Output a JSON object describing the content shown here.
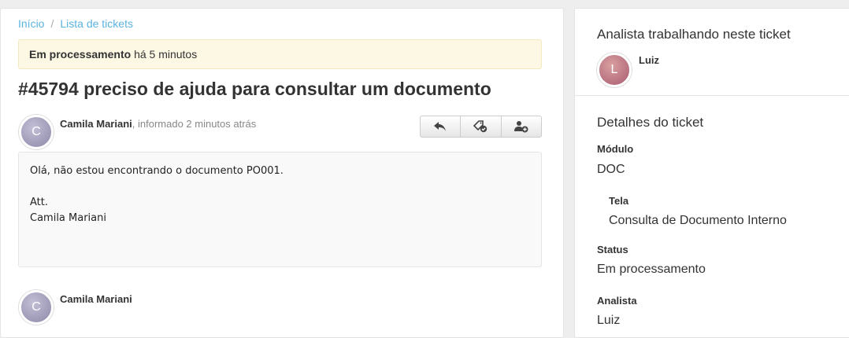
{
  "breadcrumb": {
    "home": "Início",
    "separator": "/",
    "list": "Lista de tickets"
  },
  "status": {
    "state": "Em processamento",
    "elapsed": "há 5 minutos"
  },
  "ticket": {
    "title": "#45794 preciso de ajuda para consultar um documento"
  },
  "comments": [
    {
      "avatar_letter": "C",
      "author": "Camila Mariani",
      "meta": ", informado 2 minutos atrás",
      "body_lines": [
        "Olá, não estou encontrando o documento PO001.",
        "",
        "Att.",
        "Camila Mariani"
      ]
    },
    {
      "avatar_letter": "C",
      "author": "Camila Mariani"
    }
  ],
  "actions": {
    "icons": [
      "reply-icon",
      "assign-ticket-icon",
      "add-user-icon"
    ]
  },
  "sidebar": {
    "analyst_title": "Analista trabalhando neste ticket",
    "analyst_name": "Luiz",
    "analyst_avatar_letter": "L",
    "details_title": "Detalhes do ticket",
    "fields": {
      "module_label": "Módulo",
      "module_value": "DOC",
      "screen_label": "Tela",
      "screen_value": "Consulta de Documento Interno",
      "status_label": "Status",
      "status_value": "Em processamento",
      "analyst_label": "Analista",
      "analyst_value": "Luiz"
    }
  },
  "colors": {
    "link": "#5bb3e0",
    "status_bg": "#fcf8e3",
    "message_bg": "#f9f9f9"
  }
}
